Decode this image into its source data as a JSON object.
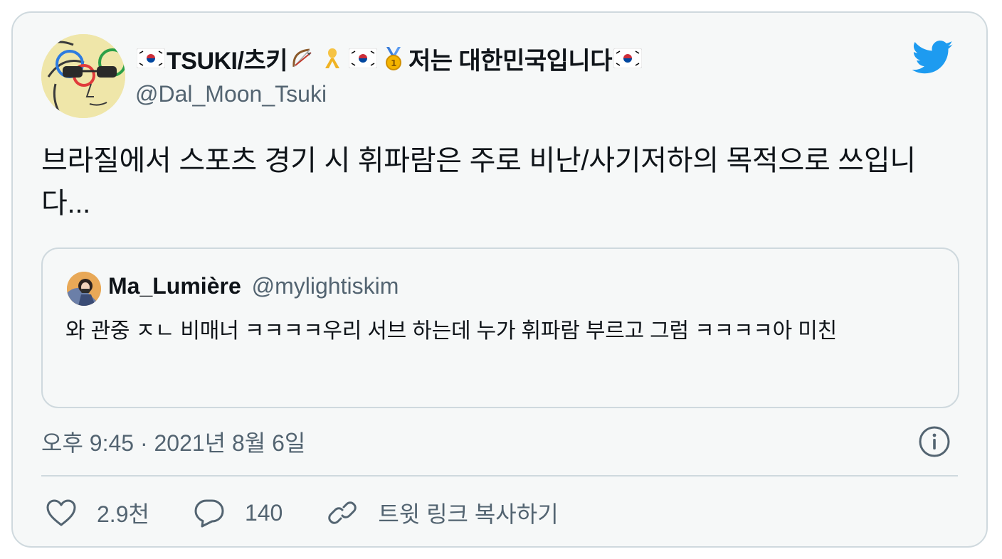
{
  "author": {
    "name_part1": "TSUKI/츠키",
    "name_part2": "저는 대한민국입니다",
    "handle": "@Dal_Moon_Tsuki"
  },
  "icons": {
    "brand": "twitter-bird-icon",
    "info": "info-icon",
    "like": "heart-icon",
    "reply": "comment-icon",
    "copy_link": "link-icon",
    "emoji_sequence": [
      "korea-flag-icon",
      "bow-and-arrow-icon",
      "yellow-ribbon-icon",
      "korea-flag-icon",
      "gold-medal-icon",
      "korea-flag-icon"
    ]
  },
  "tweet": {
    "text": "브라질에서 스포츠 경기 시 휘파람은 주로 비난/사기저하의 목적으로 쓰입니다..."
  },
  "quoted": {
    "name": "Ma_Lumière",
    "handle": "@mylightiskim",
    "text": "와 관중 ㅈㄴ 비매너 ㅋㅋㅋㅋ우리 서브 하는데 누가 휘파람 부르고 그럼 ㅋㅋㅋㅋ아 미친"
  },
  "meta": {
    "timestamp": "오후 9:45 · 2021년 8월 6일"
  },
  "actions": {
    "likes": "2.9천",
    "replies": "140",
    "copy_link": "트윗 링크 복사하기"
  },
  "colors": {
    "brand": "#1d9bf0",
    "text": "#0f1419",
    "secondary": "#536471",
    "border": "#cfd9de",
    "card_bg": "#f6f8f8"
  }
}
